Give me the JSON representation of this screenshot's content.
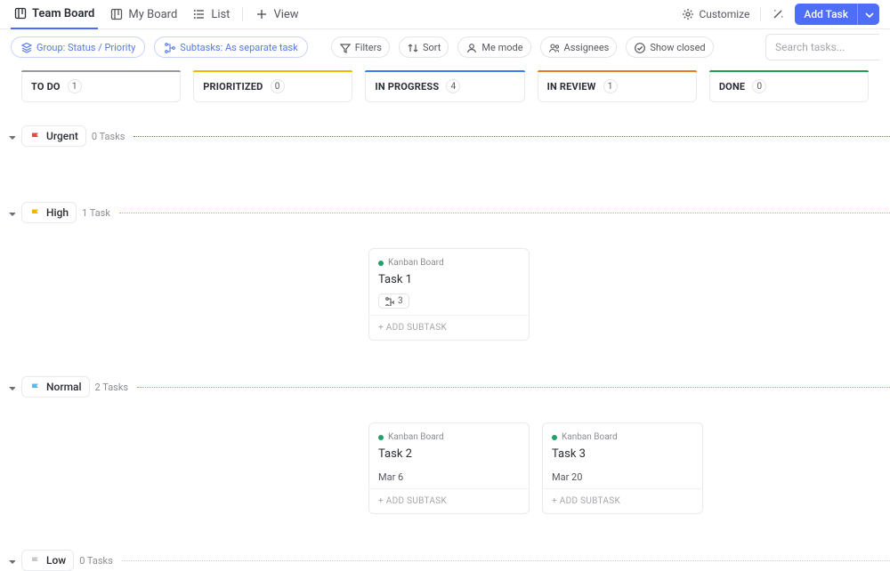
{
  "tabs": {
    "teamboard": "Team Board",
    "myboard": "My Board",
    "list": "List",
    "view": "View"
  },
  "topright": {
    "customize": "Customize",
    "addtask": "Add Task"
  },
  "filters": {
    "group": "Group: Status / Priority",
    "subtasks": "Subtasks: As separate task",
    "filters": "Filters",
    "sort": "Sort",
    "me": "Me mode",
    "assignees": "Assignees",
    "closed": "Show closed",
    "search_ph": "Search tasks..."
  },
  "columns": [
    {
      "name": "TO DO",
      "count": "1",
      "color": "#97989c"
    },
    {
      "name": "PRIORITIZED",
      "count": "0",
      "color": "#f2b600"
    },
    {
      "name": "IN PROGRESS",
      "count": "4",
      "color": "#3a7af2"
    },
    {
      "name": "IN REVIEW",
      "count": "1",
      "color": "#e87b1b"
    },
    {
      "name": "DONE",
      "count": "0",
      "color": "#1f9e52"
    }
  ],
  "groups": {
    "urgent": {
      "label": "Urgent",
      "tasks": "0 Tasks",
      "flag": "#e24a4a"
    },
    "high": {
      "label": "High",
      "tasks": "1 Task",
      "flag": "#f2b600"
    },
    "normal": {
      "label": "Normal",
      "tasks": "2 Tasks",
      "flag": "#5bb7e8"
    },
    "low": {
      "label": "Low",
      "tasks": "0 Tasks",
      "flag": "#c7c9cc"
    }
  },
  "cards": {
    "task1": {
      "project": "Kanban Board",
      "title": "Task 1",
      "sub": "3",
      "addsub": "+ ADD SUBTASK"
    },
    "task2": {
      "project": "Kanban Board",
      "title": "Task 2",
      "date": "Mar 6",
      "addsub": "+ ADD SUBTASK"
    },
    "task3": {
      "project": "Kanban Board",
      "title": "Task 3",
      "date": "Mar 20",
      "addsub": "+ ADD SUBTASK"
    }
  }
}
